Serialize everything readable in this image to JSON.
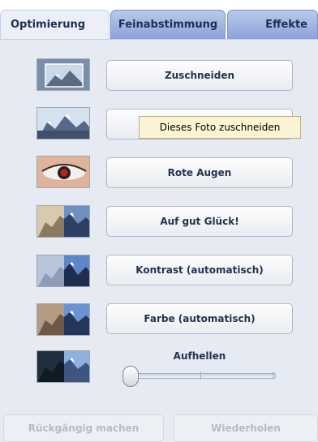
{
  "tabs": [
    {
      "label": "Optimierung",
      "active": true
    },
    {
      "label": "Feinabstimmung",
      "active": false
    },
    {
      "label": "Effekte",
      "active": false
    }
  ],
  "actions": {
    "crop": "Zuschneiden",
    "straighten": "",
    "red_eye": "Rote Augen",
    "lucky": "Auf gut Glück!",
    "auto_contrast": "Kontrast (automatisch)",
    "auto_color": "Farbe (automatisch)"
  },
  "tooltip": "Dieses Foto zuschneiden",
  "brighten": {
    "label": "Aufhellen",
    "value": 0
  },
  "footer": {
    "undo": "Rückgängig machen",
    "redo": "Wiederholen"
  },
  "colors": {
    "tab_active_bg": "#ecf0f6",
    "tab_inactive_bg": "#9fb3e0",
    "panel_bg": "#e6eaf2",
    "tooltip_bg": "#fbf4d4"
  }
}
